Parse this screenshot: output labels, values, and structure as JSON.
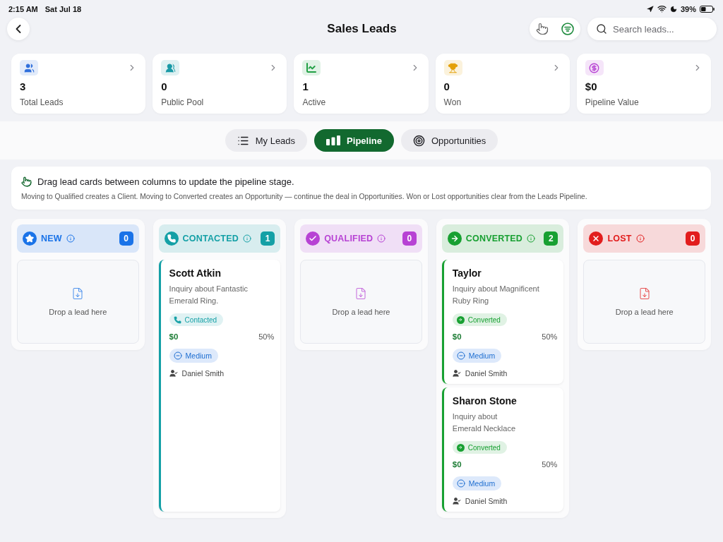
{
  "status_bar": {
    "time": "2:15 AM",
    "date": "Sat Jul 18",
    "battery": "39%"
  },
  "header": {
    "title": "Sales Leads",
    "search": {
      "placeholder": "Search leads..."
    }
  },
  "stats": [
    {
      "kind": "total",
      "value": "3",
      "label": "Total Leads",
      "color": "#2f6fdc"
    },
    {
      "kind": "pool",
      "value": "0",
      "label": "Public Pool",
      "color": "#1a9aa6"
    },
    {
      "kind": "active",
      "value": "1",
      "label": "Active",
      "color": "#22a045"
    },
    {
      "kind": "won",
      "value": "0",
      "label": "Won",
      "color": "#e3a008"
    },
    {
      "kind": "value",
      "value": "$0",
      "label": "Pipeline Value",
      "color": "#b845d4"
    }
  ],
  "tabs": [
    {
      "kind": "list",
      "label": "My Leads",
      "selected": false
    },
    {
      "kind": "pipeline",
      "label": "Pipeline",
      "selected": true
    },
    {
      "kind": "target",
      "label": "Opportunities",
      "selected": false
    }
  ],
  "info": {
    "title": "Drag lead cards between columns to update the pipeline stage.",
    "text": "Moving to Qualified creates a Client. Moving to Converted creates an Opportunity — continue the deal in Opportunities. Won or Lost opportunities clear from the Leads Pipeline."
  },
  "columns": [
    {
      "kind": "new",
      "title": "NEW",
      "count": "0",
      "color": "#1a73e8",
      "empty_text": "Drop a lead here"
    },
    {
      "kind": "contacted",
      "title": "CONTACTED",
      "count": "1",
      "color": "#14a0a6",
      "leads": [
        {
          "name": "Scott Atkin",
          "description": "Inquiry about Fantastic\nEmerald Ring.",
          "status": "Contacted",
          "value": "$0",
          "probability": "50%",
          "priority": "Medium",
          "owner": "Daniel Smith"
        }
      ]
    },
    {
      "kind": "qualified",
      "title": "QUALIFIED",
      "count": "0",
      "color": "#b742d4",
      "empty_text": "Drop a lead here"
    },
    {
      "kind": "converted",
      "title": "CONVERTED",
      "count": "2",
      "color": "#18a032",
      "leads": [
        {
          "name": "Taylor",
          "description": "Inquiry about Magnificent\nRuby Ring",
          "status": "Converted",
          "value": "$0",
          "probability": "50%",
          "priority": "Medium",
          "owner": "Daniel Smith"
        },
        {
          "name": "Sharon Stone",
          "description": "Inquiry about\nEmerald Necklace",
          "status": "Converted",
          "value": "$0",
          "probability": "50%",
          "priority": "Medium",
          "owner": "Daniel Smith"
        }
      ]
    },
    {
      "kind": "lost",
      "title": "LOST",
      "count": "0",
      "color": "#e21d1d",
      "empty_text": "Drop a lead here"
    }
  ]
}
